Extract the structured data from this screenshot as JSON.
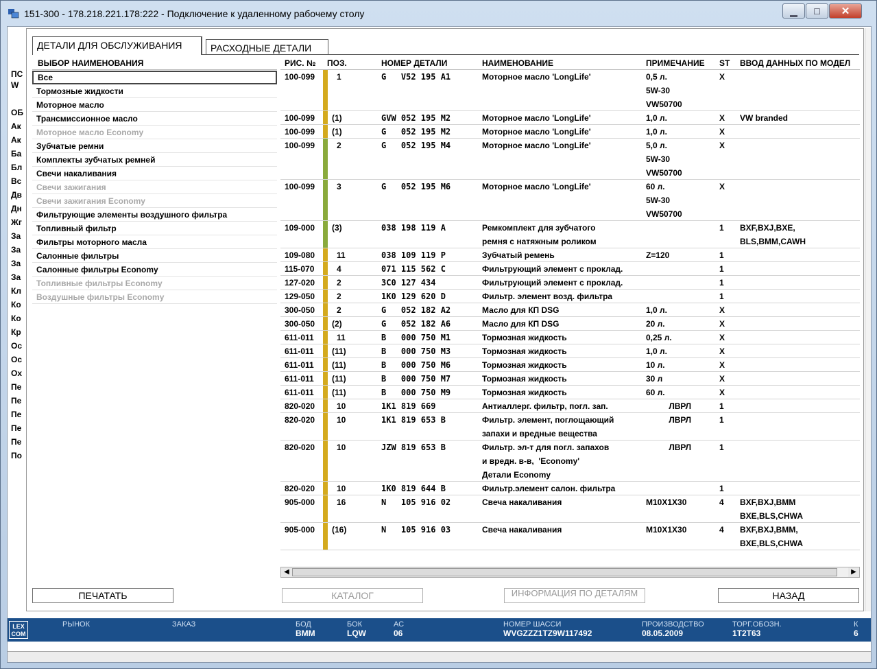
{
  "window": {
    "title": "151-300 - 178.218.221.178:222 - Подключение к удаленному рабочему столу"
  },
  "bg_strip": [
    "ПС",
    "W",
    "ОБ",
    "Ак",
    "Ак",
    "Ба",
    "Бл",
    "Вс",
    "Дв",
    "Дн",
    "Жг",
    "За",
    "За",
    "За",
    "За",
    "Кл",
    "Ко",
    "Ко",
    "Кр",
    "Ос",
    "Ос",
    "Ох",
    "Пе",
    "Пе",
    "Пе",
    "Пе",
    "Пе",
    "По"
  ],
  "tabs": {
    "service": "ДЕТАЛИ ДЛЯ ОБСЛУЖИВАНИЯ",
    "consumable": "РАСХОДНЫЕ ДЕТАЛИ"
  },
  "left_panel": {
    "header": "ВЫБОР НАИМЕНОВАНИЯ",
    "items": [
      {
        "label": "Все",
        "state": "selected"
      },
      {
        "label": "Тормозные жидкости",
        "state": "normal"
      },
      {
        "label": "Моторное масло",
        "state": "normal"
      },
      {
        "label": "Трансмиссионное масло",
        "state": "normal"
      },
      {
        "label": "Моторное масло Economy",
        "state": "disabled"
      },
      {
        "label": "Зубчатые ремни",
        "state": "normal"
      },
      {
        "label": "Комплекты зубчатых ремней",
        "state": "normal"
      },
      {
        "label": "Свечи накаливания",
        "state": "normal"
      },
      {
        "label": "Свечи зажигания",
        "state": "disabled"
      },
      {
        "label": "Свечи зажигания Economy",
        "state": "disabled"
      },
      {
        "label": "Фильтрующие элементы воздушного фильтра",
        "state": "normal"
      },
      {
        "label": "Топливный фильтр",
        "state": "normal"
      },
      {
        "label": "Фильтры моторного масла",
        "state": "normal"
      },
      {
        "label": "Салонные фильтры",
        "state": "normal"
      },
      {
        "label": "Салонные фильтры Economy",
        "state": "normal"
      },
      {
        "label": "Топливные фильтры Economy",
        "state": "disabled"
      },
      {
        "label": "Воздушные фильтры Economy",
        "state": "disabled"
      }
    ]
  },
  "table": {
    "headers": {
      "fig": "РИС. №",
      "pos": "ПОЗ.",
      "part": "НОМЕР ДЕТАЛИ",
      "name": "НАИМЕНОВАНИЕ",
      "note": "ПРИМЕЧАНИЕ",
      "st": "ST",
      "model": "ВВОД ДАННЫХ ПО МОДЕЛ"
    },
    "colors": {
      "yellow": "#d4aa1e",
      "green": "#8aaa3c"
    },
    "rows": [
      {
        "fig": "100-099",
        "bar": "yellow",
        "pos": "1",
        "part": "G   V52 195 A1",
        "name": [
          "Моторное масло 'LongLife'"
        ],
        "note": [
          "0,5 л.",
          "5W-30",
          "VW50700"
        ],
        "st": "X",
        "model": []
      },
      {
        "fig": "100-099",
        "bar": "yellow",
        "pos": "(1)",
        "part": "GVW 052 195 M2",
        "name": [
          "Моторное масло 'LongLife'"
        ],
        "note": [
          "1,0 л."
        ],
        "st": "X",
        "model": [
          "VW branded"
        ]
      },
      {
        "fig": "100-099",
        "bar": "yellow",
        "pos": "(1)",
        "part": "G   052 195 M2",
        "name": [
          "Моторное масло 'LongLife'"
        ],
        "note": [
          "1,0 л."
        ],
        "st": "X",
        "model": []
      },
      {
        "fig": "100-099",
        "bar": "green",
        "pos": "2",
        "part": "G   052 195 M4",
        "name": [
          "Моторное масло 'LongLife'"
        ],
        "note": [
          "5,0 л.",
          "5W-30",
          "VW50700"
        ],
        "st": "X",
        "model": []
      },
      {
        "fig": "100-099",
        "bar": "green",
        "pos": "3",
        "part": "G   052 195 M6",
        "name": [
          "Моторное масло 'LongLife'"
        ],
        "note": [
          "60 л.",
          "5W-30",
          "VW50700"
        ],
        "st": "X",
        "model": []
      },
      {
        "fig": "109-000",
        "bar": "green",
        "pos": "(3)",
        "part": "038 198 119 A",
        "name": [
          "Ремкомплект для зубчатого",
          "ремня с натяжным роликом"
        ],
        "note": [],
        "st": "1",
        "model": [
          "BXF,BXJ,BXE,",
          "BLS,BMM,CAWH"
        ]
      },
      {
        "fig": "109-080",
        "bar": "yellow",
        "pos": "11",
        "part": "038 109 119 P",
        "name": [
          "Зубчатый ремень"
        ],
        "note": [
          "Z=120"
        ],
        "st": "1",
        "model": []
      },
      {
        "fig": "115-070",
        "bar": "yellow",
        "pos": "4",
        "part": "071 115 562 C",
        "name": [
          "Фильтрующий элемент с проклад."
        ],
        "note": [],
        "st": "1",
        "model": []
      },
      {
        "fig": "127-020",
        "bar": "yellow",
        "pos": "2",
        "part": "3C0 127 434",
        "name": [
          "Фильтрующий элемент с проклад."
        ],
        "note": [],
        "st": "1",
        "model": []
      },
      {
        "fig": "129-050",
        "bar": "yellow",
        "pos": "2",
        "part": "1K0 129 620 D",
        "name": [
          "Фильтр. элемент возд. фильтра"
        ],
        "note": [],
        "st": "1",
        "model": []
      },
      {
        "fig": "300-050",
        "bar": "yellow",
        "pos": "2",
        "part": "G   052 182 A2",
        "name": [
          "Масло для КП DSG"
        ],
        "note": [
          "1,0 л."
        ],
        "st": "X",
        "model": []
      },
      {
        "fig": "300-050",
        "bar": "yellow",
        "pos": "(2)",
        "part": "G   052 182 A6",
        "name": [
          "Масло для КП DSG"
        ],
        "note": [
          "20 л."
        ],
        "st": "X",
        "model": []
      },
      {
        "fig": "611-011",
        "bar": "yellow",
        "pos": "11",
        "part": "B   000 750 M1",
        "name": [
          "Тормозная жидкость"
        ],
        "note": [
          "0,25 л."
        ],
        "st": "X",
        "model": []
      },
      {
        "fig": "611-011",
        "bar": "yellow",
        "pos": "(11)",
        "part": "B   000 750 M3",
        "name": [
          "Тормозная жидкость"
        ],
        "note": [
          "1,0 л."
        ],
        "st": "X",
        "model": []
      },
      {
        "fig": "611-011",
        "bar": "yellow",
        "pos": "(11)",
        "part": "B   000 750 M6",
        "name": [
          "Тормозная жидкость"
        ],
        "note": [
          "10 л."
        ],
        "st": "X",
        "model": []
      },
      {
        "fig": "611-011",
        "bar": "yellow",
        "pos": "(11)",
        "part": "B   000 750 M7",
        "name": [
          "Тормозная жидкость"
        ],
        "note": [
          "30 л"
        ],
        "st": "X",
        "model": []
      },
      {
        "fig": "611-011",
        "bar": "yellow",
        "pos": "(11)",
        "part": "B   000 750 M9",
        "name": [
          "Тормозная жидкость"
        ],
        "note": [
          "60 л."
        ],
        "st": "X",
        "model": []
      },
      {
        "fig": "820-020",
        "bar": "yellow",
        "pos": "10",
        "part": "1K1 819 669",
        "name": [
          "Антиаллерг. фильтр, погл. зап."
        ],
        "note": [
          "          ЛВРЛ"
        ],
        "st": "1",
        "model": []
      },
      {
        "fig": "820-020",
        "bar": "yellow",
        "pos": "10",
        "part": "1K1 819 653 B",
        "name": [
          "Фильтр. элемент, поглощающий",
          "запахи и вредные вещества"
        ],
        "note": [
          "          ЛВРЛ"
        ],
        "st": "1",
        "model": []
      },
      {
        "fig": "820-020",
        "bar": "yellow",
        "pos": "10",
        "part": "JZW 819 653 B",
        "name": [
          "Фильтр. эл-т для погл. запахов",
          "и вредн. в-в,  'Economy'",
          "Детали Economy"
        ],
        "note": [
          "          ЛВРЛ"
        ],
        "st": "1",
        "model": []
      },
      {
        "fig": "820-020",
        "bar": "yellow",
        "pos": "10",
        "part": "1K0 819 644 B",
        "name": [
          "Фильтр.элемент салон. фильтра"
        ],
        "note": [],
        "st": "1",
        "model": []
      },
      {
        "fig": "905-000",
        "bar": "yellow",
        "pos": "16",
        "part": "N   105 916 02",
        "name": [
          "Свеча накаливания"
        ],
        "note": [
          "M10X1X30"
        ],
        "st": "4",
        "model": [
          "BXF,BXJ,BMM",
          "BXE,BLS,CHWA"
        ]
      },
      {
        "fig": "905-000",
        "bar": "yellow",
        "pos": "(16)",
        "part": "N   105 916 03",
        "name": [
          "Свеча накаливания"
        ],
        "note": [
          "M10X1X30"
        ],
        "st": "4",
        "model": [
          "BXF,BXJ,BMM,",
          "BXE,BLS,CHWA"
        ]
      }
    ]
  },
  "buttons": {
    "print": "ПЕЧАТАТЬ",
    "catalog": "КАТАЛОГ",
    "info": "ИНФОРМАЦИЯ ПО ДЕТАЛЯМ",
    "back": "НАЗАД"
  },
  "statusbar": {
    "logo": "LEX COM",
    "fields": [
      {
        "label": "РЫНОК",
        "value": ""
      },
      {
        "label": "ЗАКАЗ",
        "value": ""
      },
      {
        "label": "БОД",
        "value": "BMM"
      },
      {
        "label": "БОК",
        "value": "LQW"
      },
      {
        "label": "АС",
        "value": "06"
      },
      {
        "label": "НОМЕР ШАССИ",
        "value": "WVGZZZ1TZ9W117492"
      },
      {
        "label": "ПРОИЗВОДСТВО",
        "value": "08.05.2009"
      },
      {
        "label": "ТОРГ.ОБОЗН.",
        "value": "1T2T63"
      },
      {
        "label": "К",
        "value": "6"
      }
    ]
  }
}
